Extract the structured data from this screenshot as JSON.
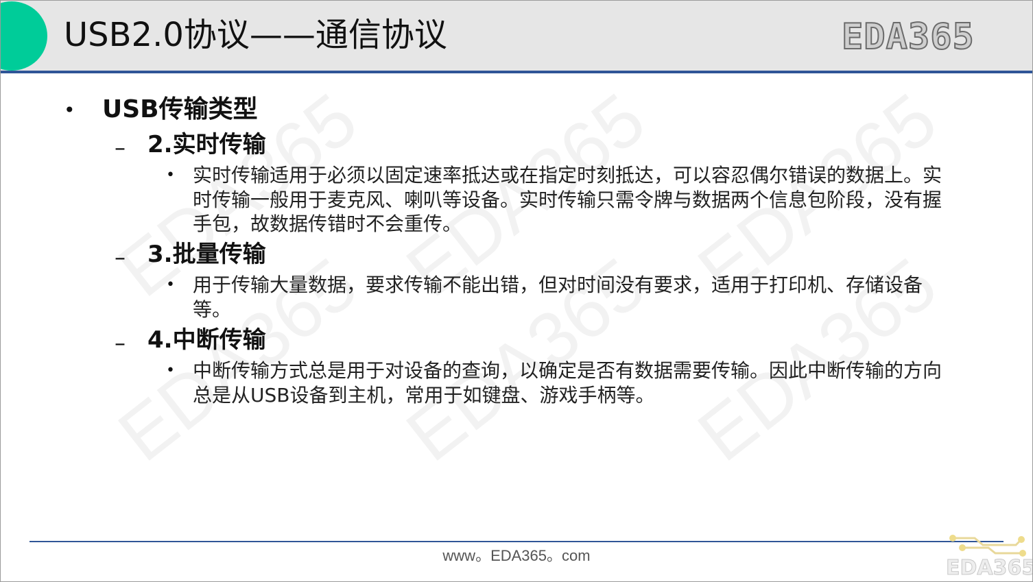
{
  "slide": {
    "title": "USB2.0协议——通信协议",
    "logo": "EDA365",
    "watermark": "EDA365"
  },
  "content": {
    "bullet_symbol": "•",
    "dash_symbol": "–",
    "heading": "USB传输类型",
    "sections": [
      {
        "title": "2.实时传输",
        "body": "实时传输适用于必须以固定速率抵达或在指定时刻抵达，可以容忍偶尔错误的数据上。实时传输一般用于麦克风、喇叭等设备。实时传输只需令牌与数据两个信息包阶段，没有握手包，故数据传错时不会重传。"
      },
      {
        "title": "3.批量传输",
        "body": "用于传输大量数据，要求传输不能出错，但对时间没有要求，适用于打印机、存储设备等。"
      },
      {
        "title": "4.中断传输",
        "body": "中断传输方式总是用于对设备的查询，以确定是否有数据需要传输。因此中断传输的方向总是从USB设备到主机，常用于如键盘、游戏手柄等。"
      }
    ]
  },
  "footer": {
    "url": "www。EDA365。com",
    "logo": "EDA365"
  },
  "colors": {
    "accent_green": "#00cc99",
    "rule_blue": "#2f5597",
    "header_gray": "#e6e6e6"
  }
}
